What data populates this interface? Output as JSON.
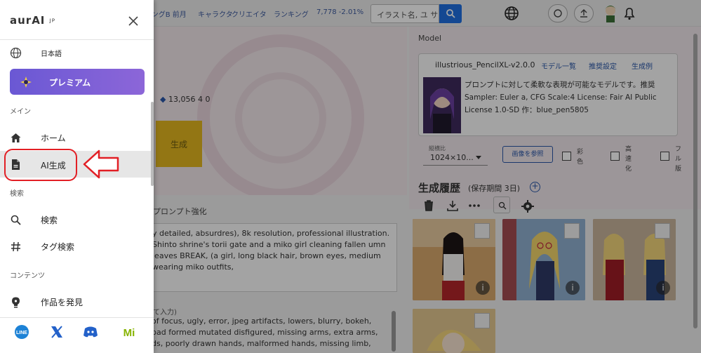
{
  "topbar": {
    "nav_items": [
      "ンキングB 前月",
      "キャラクタ",
      "クリエイタ",
      "ランキング",
      "7,778 -2.01%"
    ],
    "search_placeholder": "イラスト名, ユ サ"
  },
  "main": {
    "stats": "13,056  4  0",
    "generate_label": "生成",
    "prompt_strength_label": "プロンプト強化",
    "prompt_text": "y detailed, absurdres), 8k resolution, professional illustration. Shinto shrine's torii gate and a miko girl cleaning fallen umn leaves BREAK, (a girl, long black hair, brown eyes, medium wearing miko outfits,",
    "negative_label": "て入力)",
    "negative_text": "of focus, ugly, error, jpeg artifacts, lowers, blurry, bokeh, bad formed mutated disfigured, missing arms, extra arms, ds, poorly drawn hands, malformed hands, missing limb,"
  },
  "model": {
    "section_label": "Model",
    "name": "illustrious_PencilXL-v2.0.0",
    "links": [
      "モデル一覧",
      "推奨設定",
      "生成例"
    ],
    "description": "プロンプトに対して柔軟な表現が可能なモデルです。推奨Sampler: Euler a, CFG Scale:4 License: Fair AI Public License 1.0-SD 作：blue_pen5805",
    "size_label": "縦横比",
    "size_value": "1024×10...",
    "ref_button": "画像を参照",
    "checkboxes": [
      "彩色",
      "高速化",
      "フル版"
    ]
  },
  "history": {
    "title": "生成履歴",
    "subtitle": "(保存期間 3日)"
  },
  "drawer": {
    "logo": "aurAI",
    "logo_suffix": "JP",
    "language": "日本語",
    "premium": "プレミアム",
    "section_main": "メイン",
    "home": "ホーム",
    "ai_gen": "AI生成",
    "section_search": "検索",
    "search": "検索",
    "tag_search": "タグ検索",
    "section_contents": "コンテンツ",
    "discover": "作品を発見",
    "social": [
      "LINE",
      "X",
      "Discord",
      "Misskey"
    ]
  },
  "colors": {
    "premium_start": "#6a58d4",
    "premium_end": "#8c66d8",
    "annotation_red": "#e21f25",
    "generate_button": "#e2b520",
    "accent_blue": "#2a57a8"
  }
}
